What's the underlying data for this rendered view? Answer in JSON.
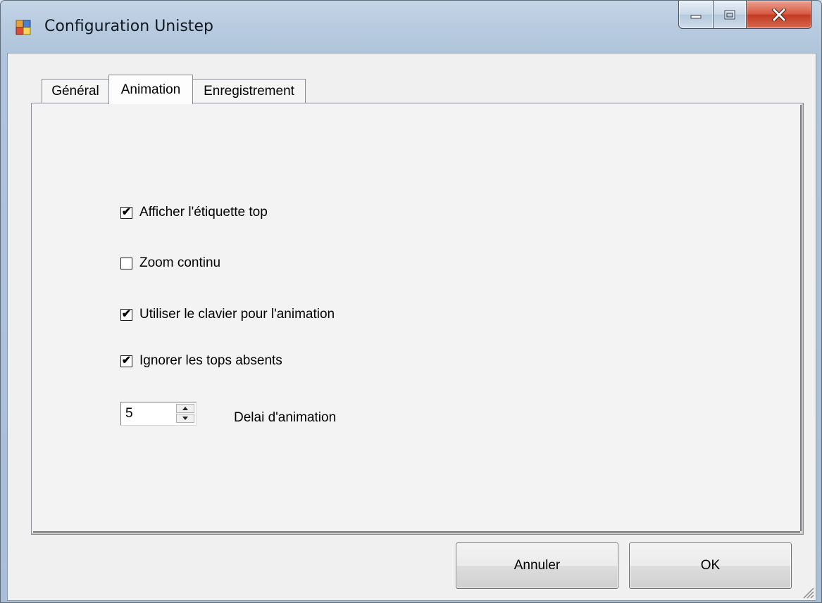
{
  "window": {
    "title": "Configuration Unistep"
  },
  "caption_buttons": {
    "minimize": "minimize-icon",
    "maximize": "maximize-icon",
    "close": "close-icon"
  },
  "tabs": [
    {
      "label": "Général",
      "selected": false
    },
    {
      "label": "Animation",
      "selected": true
    },
    {
      "label": "Enregistrement",
      "selected": false
    }
  ],
  "options": [
    {
      "label": "Afficher l'étiquette top",
      "checked": true
    },
    {
      "label": "Zoom continu",
      "checked": false
    },
    {
      "label": "Utiliser le clavier pour l'animation",
      "checked": true
    },
    {
      "label": "Ignorer les tops absents",
      "checked": true
    }
  ],
  "delay": {
    "value": "5",
    "label": "Delai d'animation"
  },
  "buttons": {
    "cancel": "Annuler",
    "ok": "OK"
  }
}
